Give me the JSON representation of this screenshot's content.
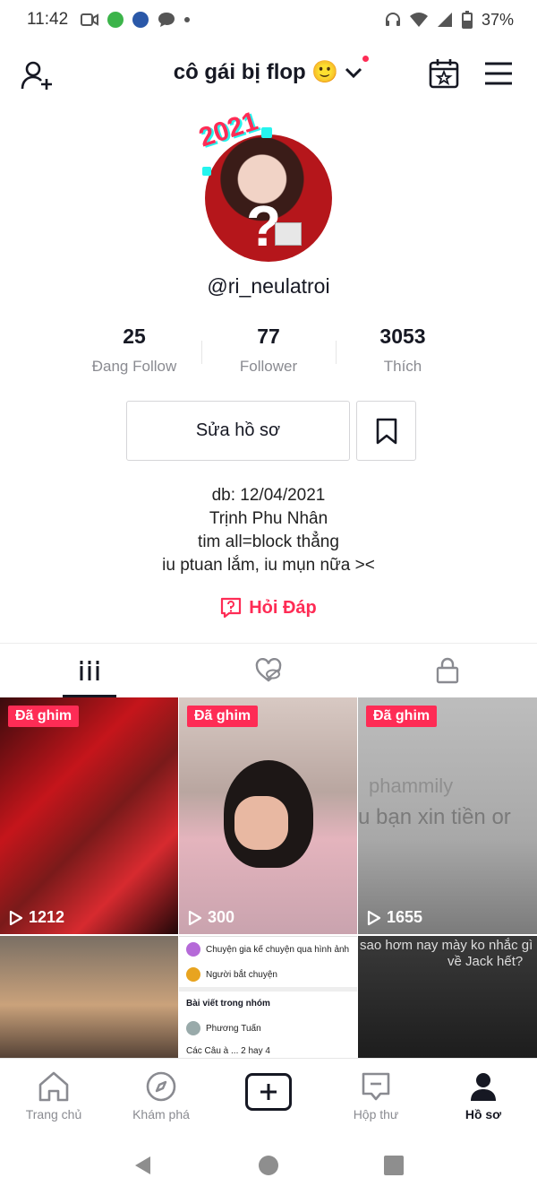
{
  "status_bar": {
    "time": "11:42",
    "battery": "37%"
  },
  "header": {
    "title": "cô gái bị flop 🙂"
  },
  "profile": {
    "avatar_badge": "2021",
    "username": "@ri_neulatroi",
    "stats": [
      {
        "value": "25",
        "label": "Đang Follow"
      },
      {
        "value": "77",
        "label": "Follower"
      },
      {
        "value": "3053",
        "label": "Thích"
      }
    ],
    "edit_button": "Sửa hồ sơ",
    "bio": [
      "db: 12/04/2021",
      "Trịnh Phu Nhân",
      "tim all=block thẳng",
      "iu ptuan lắm, iu mụn nữa ><"
    ],
    "qa_label": "Hỏi Đáp"
  },
  "tabs": [
    "videos-tab",
    "liked-tab",
    "private-tab"
  ],
  "videos": [
    {
      "pinned": "Đã ghim",
      "views": "1212"
    },
    {
      "pinned": "Đã ghim",
      "views": "300"
    },
    {
      "pinned": "Đã ghim",
      "views": "1655",
      "overlay_line1": "phammily",
      "overlay_line2": "u bạn xin tiền or"
    },
    {},
    {
      "row1": "Chuyện gia kế chuyện qua hình ảnh",
      "row2": "Người bắt chuyện",
      "header": "Bài viết trong nhóm",
      "author": "Phương Tuấn",
      "snippet": "Các Câu à ... 2 hay 4"
    },
    {
      "overlay_line1": "sao hơm nay mày ko nhắc gì",
      "overlay_line2": "về Jack hết?"
    }
  ],
  "bottom_nav": [
    {
      "label": "Trang chủ"
    },
    {
      "label": "Khám phá"
    },
    {
      "label": ""
    },
    {
      "label": "Hộp thư"
    },
    {
      "label": "Hồ sơ"
    }
  ],
  "colors": {
    "accent": "#fe2c55",
    "text": "#161823",
    "muted": "#8a8b91"
  }
}
